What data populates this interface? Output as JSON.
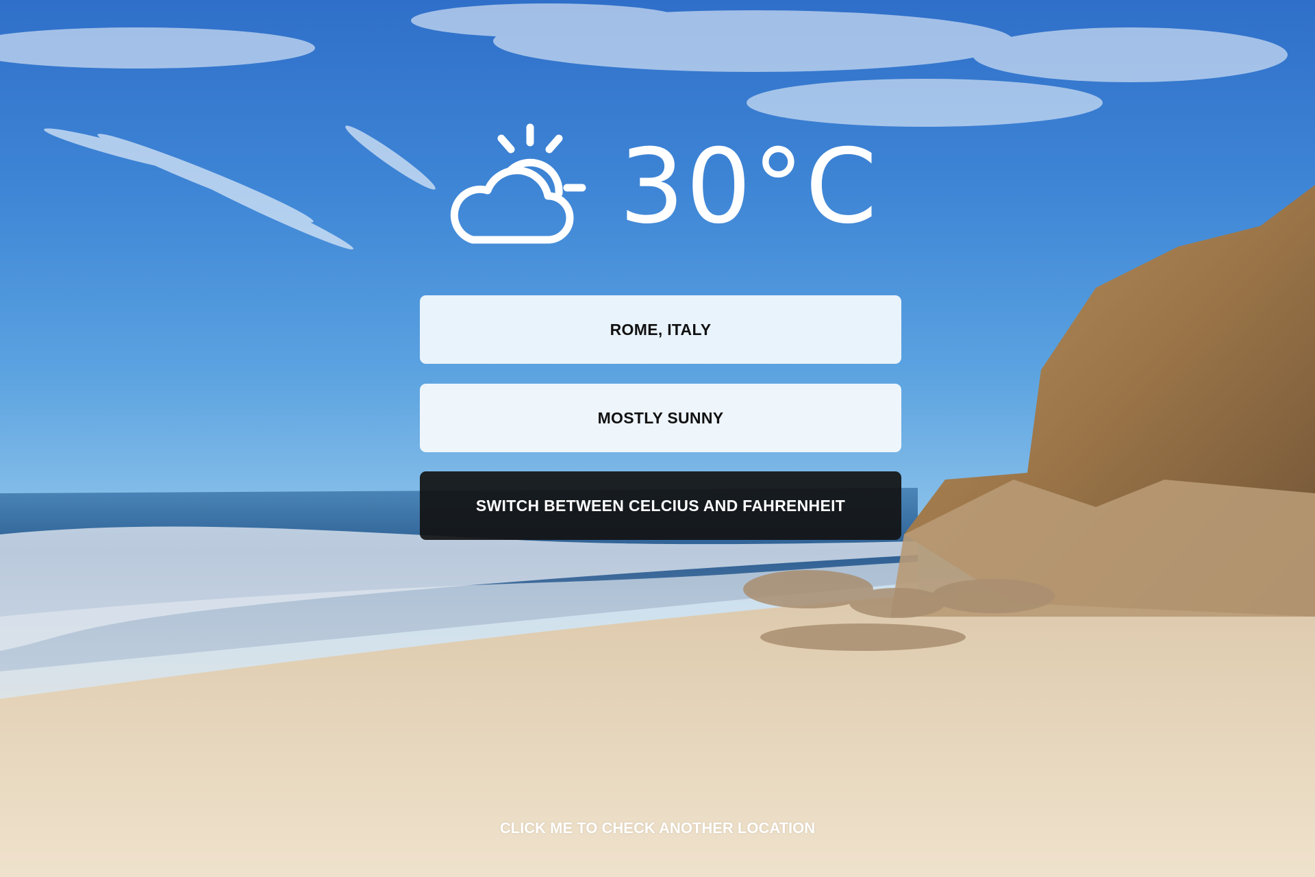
{
  "weather": {
    "temperature": "30°C",
    "icon": "partly-cloudy-icon",
    "location": "ROME, ITALY",
    "condition": "MOSTLY SUNNY"
  },
  "actions": {
    "switch_units_label": "SWITCH BETWEEN CELCIUS AND FAHRENHEIT",
    "check_location_label": "CLICK ME TO CHECK ANOTHER LOCATION"
  },
  "colors": {
    "text_light": "#ffffff",
    "panel_light": "#f4fafd",
    "panel_dark": "#121212"
  }
}
